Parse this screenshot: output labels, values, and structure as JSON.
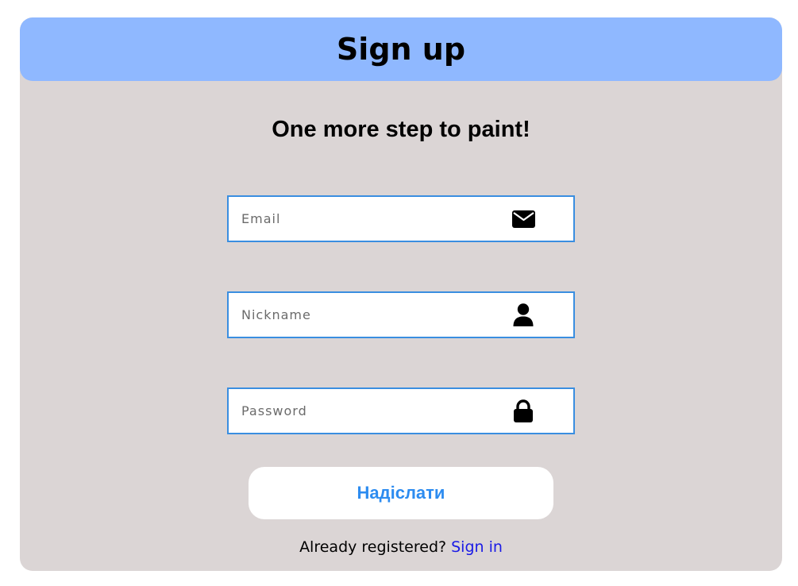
{
  "header": {
    "title": "Sign up"
  },
  "subtitle": "One more step to paint!",
  "form": {
    "email": {
      "placeholder": "Email",
      "value": "",
      "icon": "envelope-icon"
    },
    "nickname": {
      "placeholder": "Nickname",
      "value": "",
      "icon": "user-icon"
    },
    "password": {
      "placeholder": "Password",
      "value": "",
      "icon": "lock-icon"
    },
    "submit_label": "Надіслати"
  },
  "footer": {
    "prompt": "Already registered?",
    "link_label": "Sign in"
  },
  "colors": {
    "header_bg": "#8fb8ff",
    "card_bg": "#dbd5d5",
    "field_border": "#3a8ee0",
    "button_text": "#2d8cf0",
    "link": "#1a1ae6"
  }
}
